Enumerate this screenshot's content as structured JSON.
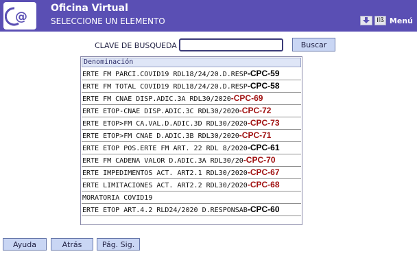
{
  "header": {
    "title": "Oficina Virtual",
    "subtitle": "SELECCIONE UN ELEMENTO",
    "menu_label": "Menú",
    "icon_text": "Ilß",
    "accent": "#5a4fb4"
  },
  "search": {
    "label": "CLAVE DE BUSQUEDA",
    "value": "",
    "button": "Buscar"
  },
  "list": {
    "header": "Denominación",
    "rows": [
      {
        "text": "ERTE FM PARCI.COVID19 RDL18/24/20.D.RESP",
        "tag": "-CPC-59",
        "tag_color": "black"
      },
      {
        "text": "ERTE FM TOTAL COVID19 RDL18/24/20.D.RESP",
        "tag": "-CPC-58",
        "tag_color": "black"
      },
      {
        "text": "ERTE FM CNAE DISP.ADIC.3A RDL30/2020",
        "tag": "-CPC-69",
        "tag_color": "red"
      },
      {
        "text": "ERTE ETOP-CNAE DISP.ADIC.3C RDL30/2020",
        "tag": "-CPC-72",
        "tag_color": "red"
      },
      {
        "text": "ERTE ETOP>FM CA.VAL.D.ADIC.3D RDL30/2020",
        "tag": "-CPC-73",
        "tag_color": "red"
      },
      {
        "text": "ERTE ETOP>FM CNAE D.ADIC.3B RDL30/2020",
        "tag": "-CPC-71",
        "tag_color": "red"
      },
      {
        "text": "ERTE ETOP POS.ERTE FM ART. 22 RDL 8/2020",
        "tag": "-CPC-61",
        "tag_color": "black"
      },
      {
        "text": "ERTE FM CADENA VALOR D.ADIC.3A RDL30/20",
        "tag": "-CPC-70",
        "tag_color": "red"
      },
      {
        "text": "ERTE IMPEDIMENTOS ACT. ART2.1 RDL30/2020",
        "tag": "-CPC-67",
        "tag_color": "red"
      },
      {
        "text": "ERTE LIMITACIONES ACT. ART2.2 RDL30/2020",
        "tag": "-CPC-68",
        "tag_color": "red"
      },
      {
        "text": "MORATORIA COVID19",
        "tag": "",
        "tag_color": "black"
      },
      {
        "text": "ERTE ETOP ART.4.2 RLD24/2020 D.RESPONSAB",
        "tag": "-CPC-60",
        "tag_color": "black"
      }
    ]
  },
  "footer": {
    "help": "Ayuda",
    "back": "Atrás",
    "next": "Pág. Sig."
  }
}
